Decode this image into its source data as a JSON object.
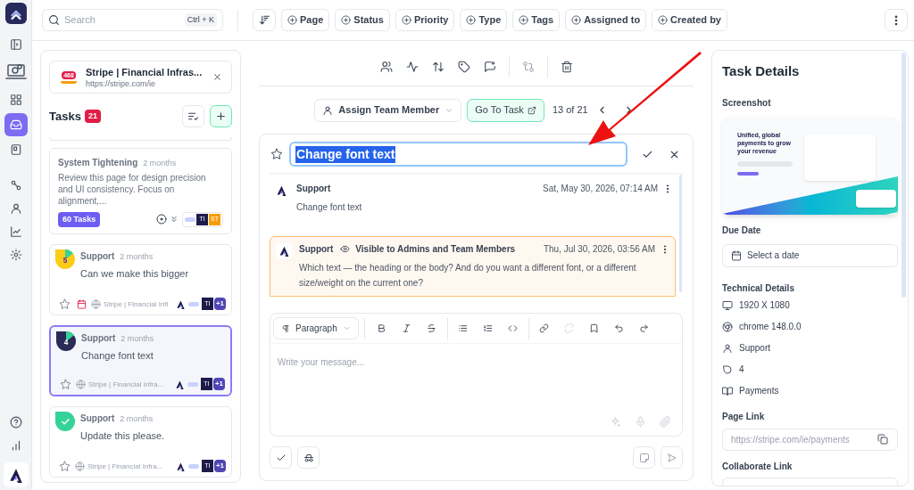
{
  "sidebar": {
    "items": [
      {
        "selected": false
      },
      {
        "selected": false
      },
      {
        "selected": false
      },
      {
        "selected": true
      },
      {
        "selected": false
      },
      {
        "selected": false
      },
      {
        "selected": false
      },
      {
        "selected": false
      },
      {
        "selected": false
      }
    ],
    "bottom_items": [
      {
        "selected": false
      },
      {
        "selected": false
      }
    ]
  },
  "search": {
    "placeholder": "Search",
    "shortcut": "Ctrl + K"
  },
  "filters": [
    "Page",
    "Status",
    "Priority",
    "Type",
    "Tags",
    "Assigned to",
    "Created by"
  ],
  "site": {
    "badge": "468",
    "title": "Stripe | Financial Infras...",
    "url": "https://stripe.com/ie"
  },
  "tasks": {
    "title": "Tasks",
    "count": "21"
  },
  "group_card": {
    "title": "System Tightening",
    "age": "2 months",
    "description": "Review this page for design precision and UI consistency. Focus on alignment,...",
    "badge": "60 Tasks",
    "avatars": [
      "TI",
      "ST"
    ]
  },
  "task_items": [
    {
      "kind": "pie",
      "color": "#facc15",
      "label": "5",
      "author": "Support",
      "age": "2 months",
      "text": "Can we make this bigger",
      "due": true,
      "site": "Stripe | Financial Infi",
      "avatars": [
        "TI"
      ],
      "more": "+1",
      "selected": false
    },
    {
      "kind": "pie",
      "color": "#2a2b57",
      "label": "4",
      "author": "Support",
      "age": "2 months",
      "text": "Change font text",
      "due": false,
      "site": "Stripe | Financial Infra...",
      "avatars": [
        "TI"
      ],
      "more": "+1",
      "selected": true
    },
    {
      "kind": "done",
      "color": "#34d399",
      "author": "Support",
      "age": "2 months",
      "text": "Update this please.",
      "due": false,
      "site": "Stripe | Financial Infra...",
      "avatars": [
        "TI"
      ],
      "more": "+1",
      "selected": false
    }
  ],
  "assign": {
    "label": "Assign Team Member"
  },
  "go_to_task": "Go To Task",
  "pager": "13 of 21",
  "title_input": {
    "value": "Change font text",
    "highlighted": true
  },
  "comments": [
    {
      "author": "Support",
      "date": "Sat, May 30, 2026, 07:14 AM",
      "text": "Change font text",
      "internal": false
    },
    {
      "author": "Support",
      "visibility": "Visible to Admins and Team Members",
      "date": "Thu, Jul 30, 2026, 03:56 AM",
      "text": "Which text — the heading or the body? And do you want a different font, or a different size/weight on the current one?",
      "internal": true
    }
  ],
  "editor": {
    "block_type": "Paragraph",
    "placeholder": "Write your message..."
  },
  "details": {
    "title": "Task Details",
    "screenshot_label": "Screenshot",
    "thumbnail_headline": "Unified, global payments to grow your revenue",
    "due_label": "Due Date",
    "due_placeholder": "Select a date",
    "tech_label": "Technical Details",
    "tech": [
      {
        "kind": "screen",
        "text": "1920 X 1080"
      },
      {
        "kind": "browser",
        "text": "chrome 148.0.0"
      },
      {
        "kind": "user",
        "text": "Support"
      },
      {
        "kind": "shape",
        "text": "4"
      },
      {
        "kind": "book",
        "text": "Payments"
      }
    ],
    "page_link_label": "Page Link",
    "page_link": "https://stripe.com/ie/payments",
    "collaborate_label": "Collaborate Link"
  }
}
